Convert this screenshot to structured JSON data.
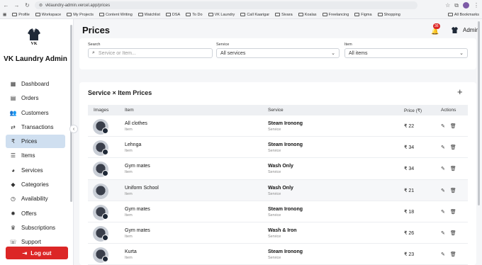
{
  "browser": {
    "url": "vklaundry-admin.vercel.app/prices",
    "bookmarks": [
      "Profile",
      "Workspace",
      "My Projects",
      "Content Writing",
      "Watchlist",
      "DSA",
      "To Do",
      "VK Laundry",
      "Call Kaarigar",
      "Sivara",
      "Koalas",
      "Freelancing",
      "Figma",
      "Shopping"
    ],
    "all_bookmarks": "All Bookmarks"
  },
  "sidebar": {
    "brand": "VK Laundry Admin",
    "logo_text": "VK",
    "items": [
      {
        "label": "Dashboard",
        "icon": "grid-icon"
      },
      {
        "label": "Orders",
        "icon": "clipboard-icon"
      },
      {
        "label": "Customers",
        "icon": "users-icon"
      },
      {
        "label": "Transactions",
        "icon": "transfer-icon"
      },
      {
        "label": "Prices",
        "icon": "rupee-icon",
        "active": true
      },
      {
        "label": "Items",
        "icon": "list-icon"
      },
      {
        "label": "Services",
        "icon": "palette-icon"
      },
      {
        "label": "Categories",
        "icon": "tag-icon"
      },
      {
        "label": "Availability",
        "icon": "clock-icon"
      },
      {
        "label": "Offers",
        "icon": "offer-icon"
      },
      {
        "label": "Subscriptions",
        "icon": "crown-icon"
      },
      {
        "label": "Support",
        "icon": "support-icon"
      }
    ],
    "logout": "Log out"
  },
  "header": {
    "title": "Prices",
    "notification_count": "36",
    "user": "Admin"
  },
  "filters": {
    "search_label": "Search",
    "search_placeholder": "Service or Item...",
    "service_label": "Service",
    "service_value": "All services",
    "item_label": "Item",
    "item_value": "All items"
  },
  "table": {
    "title": "Service × Item Prices",
    "headers": {
      "images": "Images",
      "item": "Item",
      "service": "Service",
      "price": "Price (₹)",
      "actions": "Actions"
    },
    "rows": [
      {
        "item": "All clothes",
        "item_sub": "Item",
        "service": "Steam Ironong",
        "service_sub": "Service",
        "price": "₹ 22"
      },
      {
        "item": "Lehnga",
        "item_sub": "Item",
        "service": "Steam Ironong",
        "service_sub": "Service",
        "price": "₹ 34"
      },
      {
        "item": "Gym mates",
        "item_sub": "Item",
        "service": "Wash Only",
        "service_sub": "Service",
        "price": "₹ 34"
      },
      {
        "item": "Uniform School",
        "item_sub": "Item",
        "service": "Wash Only",
        "service_sub": "Service",
        "price": "₹ 21"
      },
      {
        "item": "Gym mates",
        "item_sub": "Item",
        "service": "Steam Ironong",
        "service_sub": "Service",
        "price": "₹ 18"
      },
      {
        "item": "Gym mates",
        "item_sub": "Item",
        "service": "Wash & Iron",
        "service_sub": "Service",
        "price": "₹ 26"
      },
      {
        "item": "Kurta",
        "item_sub": "Item",
        "service": "Steam Ironong",
        "service_sub": "Service",
        "price": "₹ 23"
      }
    ]
  },
  "colors": {
    "accent_active": "#cfdff0",
    "logout": "#dc2626",
    "badge": "#dc2626"
  }
}
